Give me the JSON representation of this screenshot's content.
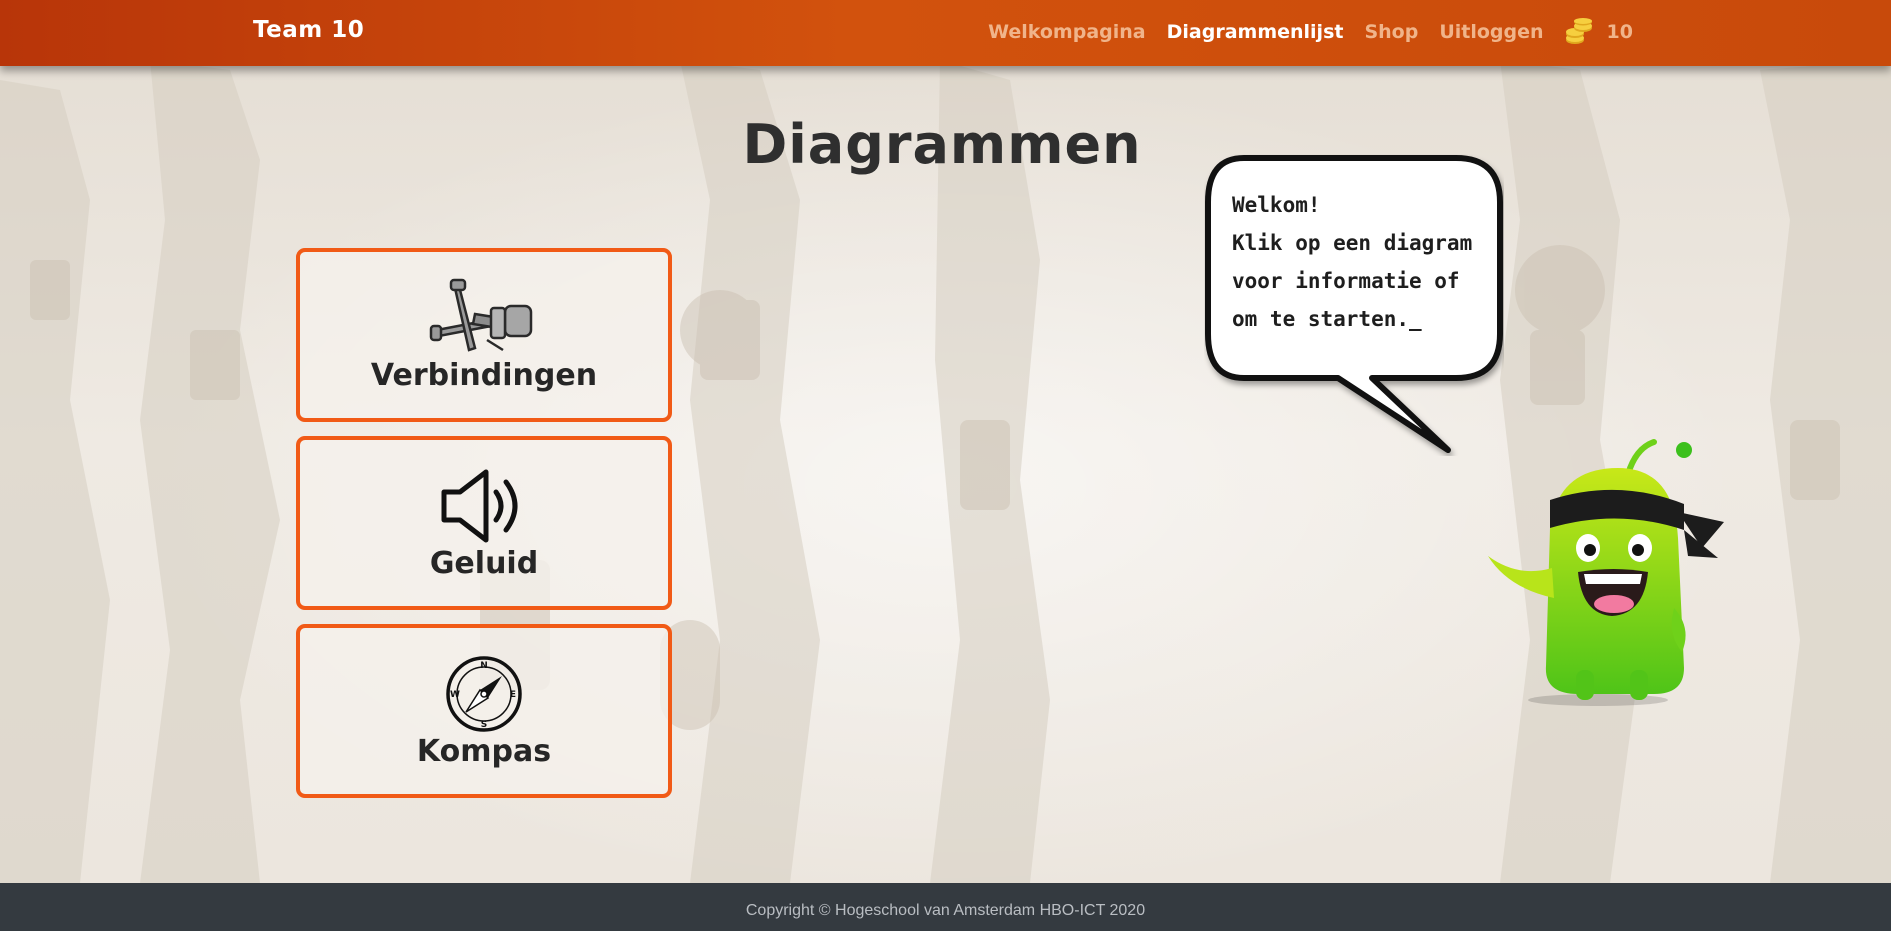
{
  "navbar": {
    "brand": "Team 10",
    "links": [
      {
        "label": "Welkompagina",
        "active": false
      },
      {
        "label": "Diagrammenlijst",
        "active": true
      },
      {
        "label": "Shop",
        "active": false
      },
      {
        "label": "Uitloggen",
        "active": false
      }
    ],
    "coins": {
      "icon": "coin-stack-icon",
      "count": "10"
    }
  },
  "main": {
    "title": "Diagrammen",
    "cards": [
      {
        "label": "Verbindingen",
        "icon": "nails-and-bolt-icon"
      },
      {
        "label": "Geluid",
        "icon": "speaker-icon"
      },
      {
        "label": "Kompas",
        "icon": "compass-icon"
      }
    ]
  },
  "speech_bubble": {
    "lines": [
      "Welkom!",
      "Klik op een diagram",
      "voor informatie of",
      "om te starten._"
    ]
  },
  "mascot": {
    "icon": "green-monster-mascot"
  },
  "compass_letters": {
    "n": "N",
    "e": "E",
    "s": "S",
    "w": "W"
  },
  "footer": {
    "copyright": "Copyright © Hogeschool van Amsterdam HBO-ICT 2020"
  },
  "colors": {
    "navbar": "#d2520d",
    "accent": "#f15a16",
    "footer": "#343a40",
    "mascot": "#8ad11a"
  }
}
